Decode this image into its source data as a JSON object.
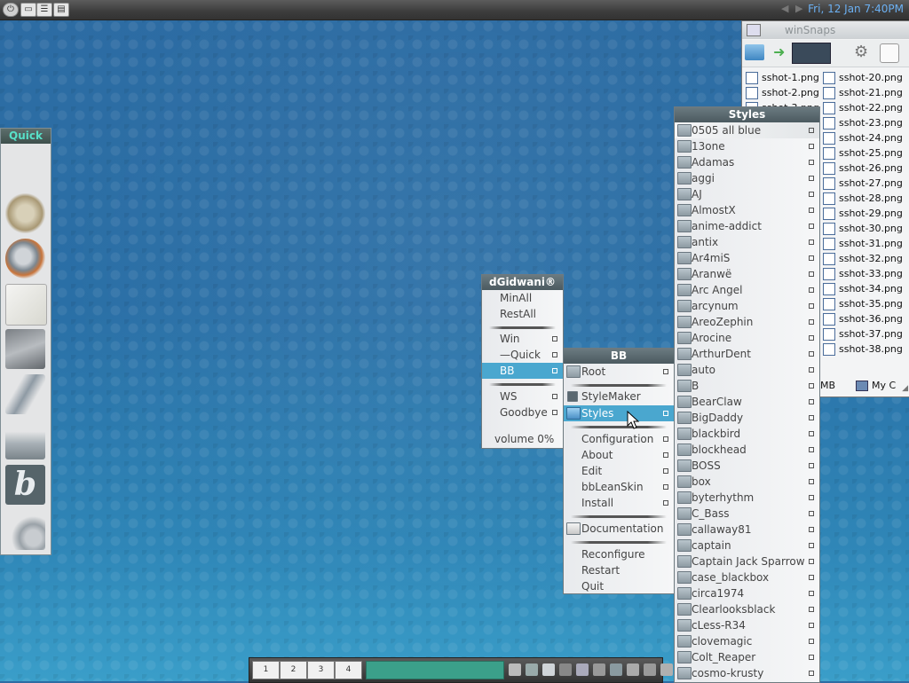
{
  "topbar": {
    "clock": "Fri, 12 Jan 7:40PM",
    "left_icons": [
      "power-icon",
      "desktop-icon",
      "list-icon",
      "folder-icon"
    ],
    "nav_icons": [
      "arrow-left-icon",
      "arrow-right-icon"
    ]
  },
  "quick": {
    "title": "Quick",
    "icons": [
      "photo-icon",
      "horns-logo-icon",
      "firefox-icon",
      "text-editor-icon",
      "book-icon",
      "feather-icon",
      "install-disk-icon",
      "bblean-b-icon",
      "settings-magnifier-icon"
    ]
  },
  "main_menu": {
    "title": "dGidwani®",
    "items": [
      "MinAll",
      "RestAll",
      "Win",
      "—Quick",
      "BB",
      "WS",
      "Goodbye",
      "volume 0%"
    ]
  },
  "bb_menu": {
    "title": "BB",
    "items": [
      "Root",
      "StyleMaker",
      "Styles",
      "Configuration",
      "About",
      "Edit",
      "bbLeanSkin",
      "Install",
      "Documentation",
      "Reconfigure",
      "Restart",
      "Quit"
    ]
  },
  "styles_menu": {
    "title": "Styles",
    "items": [
      "0505 all blue",
      "13one",
      "Adamas",
      "aggi",
      "AJ",
      "AlmostX",
      "anime-addict",
      "antix",
      "Ar4miS",
      "Aranwë",
      "Arc Angel",
      "arcynum",
      "AreoZephin",
      "Arocine",
      "ArthurDent",
      "auto",
      "B",
      "BearClaw",
      "BigDaddy",
      "blackbird",
      "blockhead",
      "BOSS",
      "box",
      "byterhythm",
      "C_Bass",
      "callaway81",
      "captain",
      "Captain Jack Sparrow",
      "case_blackbox",
      "circa1974",
      "Clearlooksblack",
      "cLess-R34",
      "clovemagic",
      "Colt_Reaper",
      "cosmo-krusty"
    ]
  },
  "winsnaps": {
    "title": "winSnaps",
    "col1": [
      "sshot-1.png",
      "sshot-2.png",
      "sshot-3.png"
    ],
    "col2": [
      "sshot-20.png",
      "sshot-21.png",
      "sshot-22.png",
      "sshot-23.png",
      "sshot-24.png",
      "sshot-25.png",
      "sshot-26.png",
      "sshot-27.png",
      "sshot-28.png",
      "sshot-29.png",
      "sshot-30.png",
      "sshot-31.png",
      "sshot-32.png",
      "sshot-33.png",
      "sshot-34.png",
      "sshot-35.png",
      "sshot-36.png",
      "sshot-37.png",
      "sshot-38.png"
    ],
    "status_size": "MB",
    "status_location": "My C"
  },
  "taskbar": {
    "workspaces": [
      "1",
      "2",
      "3",
      "4"
    ],
    "tray_icons": [
      "pause-icon",
      "speaker-icon",
      "brush-icon",
      "network-icon",
      "monitor-icon",
      "skin-icon",
      "swirl-icon",
      "hook-icon",
      "person-icon",
      "picture-icon"
    ]
  }
}
